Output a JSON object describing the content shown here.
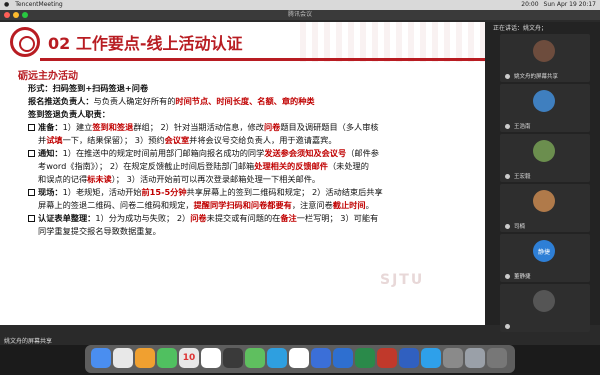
{
  "menubar": {
    "app_name": "TencentMeeting",
    "clock": "Sun Apr 19  20:17",
    "left_items": [
      "",
      "",
      "",
      "",
      "",
      ""
    ],
    "right_items": [
      "20:00"
    ]
  },
  "window": {
    "title": "腾讯会议",
    "share_label": "姚文舟的屏幕共享"
  },
  "slide": {
    "title": "02 工作要点-线上活动认证",
    "section": "砺远主办活动",
    "watermark": "SJTU",
    "lines": [
      {
        "parts": [
          {
            "t": "形式：扫码签到+扫码签退+问卷",
            "c": "bold"
          }
        ]
      },
      {
        "parts": [
          {
            "t": "报名推送负责人：",
            "c": "bold"
          },
          {
            "t": "与负责人确定好所有的",
            "c": ""
          },
          {
            "t": "时间节点、时间长度、名额、章的种类",
            "c": "red"
          }
        ]
      },
      {
        "parts": [
          {
            "t": "签到签退负责人职责：",
            "c": "bold"
          }
        ]
      },
      {
        "bullet": true,
        "parts": [
          {
            "t": "准备：",
            "c": "bold"
          },
          {
            "t": "1）建立",
            "c": ""
          },
          {
            "t": "签到和签退",
            "c": "red"
          },
          {
            "t": "群组；  2）针对当期活动信息，修改",
            "c": ""
          },
          {
            "t": "问卷",
            "c": "red"
          },
          {
            "t": "题目及调研题目（多人审核",
            "c": ""
          }
        ]
      },
      {
        "indent": true,
        "parts": [
          {
            "t": "并",
            "c": ""
          },
          {
            "t": "试填",
            "c": "red"
          },
          {
            "t": "一下，结果保留）；  3）预约",
            "c": ""
          },
          {
            "t": "会议室",
            "c": "red"
          },
          {
            "t": "并将会议号交给负责人，用于邀请嘉宾。",
            "c": ""
          }
        ]
      },
      {
        "bullet": true,
        "parts": [
          {
            "t": "通知：",
            "c": "bold"
          },
          {
            "t": "1）在推送中的规定时间前用部门邮箱向报名成功的同学",
            "c": ""
          },
          {
            "t": "发送参会须知及会议号",
            "c": "red"
          },
          {
            "t": "（邮件参",
            "c": ""
          }
        ]
      },
      {
        "indent": true,
        "parts": [
          {
            "t": "考word《指南》）；  2）在规定反馈截止时间后登陆部门邮箱",
            "c": ""
          },
          {
            "t": "处理相关的反馈邮件",
            "c": "red"
          },
          {
            "t": "（未处理的",
            "c": ""
          }
        ]
      },
      {
        "indent": true,
        "parts": [
          {
            "t": "和误点的记得",
            "c": ""
          },
          {
            "t": "标未读",
            "c": "red"
          },
          {
            "t": "）；  3）活动开始前可以再次登录邮箱处理一下相关邮件。",
            "c": ""
          }
        ]
      },
      {
        "bullet": true,
        "parts": [
          {
            "t": "现场：",
            "c": "bold"
          },
          {
            "t": "1）老规矩，活动开始",
            "c": ""
          },
          {
            "t": "前15-5分钟",
            "c": "red"
          },
          {
            "t": "共享屏幕上的签到二维码和规定；  2）活动结束后共享",
            "c": ""
          }
        ]
      },
      {
        "indent": true,
        "parts": [
          {
            "t": "屏幕上的签退二维码、问卷二维码和规定，",
            "c": ""
          },
          {
            "t": "提醒同学扫码和问卷都要有",
            "c": "red"
          },
          {
            "t": "，注意问卷",
            "c": ""
          },
          {
            "t": "截止时间",
            "c": "red"
          },
          {
            "t": "。",
            "c": ""
          }
        ]
      },
      {
        "bullet": true,
        "parts": [
          {
            "t": "认证表单整理：",
            "c": "bold"
          },
          {
            "t": "1）分为成功与失败；  2）",
            "c": ""
          },
          {
            "t": "问卷",
            "c": "red"
          },
          {
            "t": "未提交或有问题的在",
            "c": ""
          },
          {
            "t": "备注",
            "c": "red"
          },
          {
            "t": "一栏写明；  3）可能有",
            "c": ""
          }
        ]
      },
      {
        "indent": true,
        "parts": [
          {
            "t": "同学重复提交报名导致数据重复。",
            "c": ""
          }
        ]
      }
    ]
  },
  "panel": {
    "speaking_label": "正在讲话：姚文舟；",
    "participants": [
      {
        "name": "姚文舟的屏幕共享",
        "avatar": "",
        "color": "#6d4c3d"
      },
      {
        "name": "王浩南",
        "avatar": "",
        "color": "#3f7fbf"
      },
      {
        "name": "王宏毅",
        "avatar": "",
        "color": "#6b8e4e"
      },
      {
        "name": "司楠",
        "avatar": "",
        "color": "#b07a4a"
      },
      {
        "name": "董静捷",
        "avatar": "静捷",
        "color": "#2e7fd6"
      },
      {
        "name": "",
        "avatar": "",
        "color": "#555555"
      }
    ]
  },
  "dock": {
    "calendar_day": "10",
    "icon_colors": [
      "#4a8ef0",
      "#e8e8e8",
      "#f0a030",
      "#50c060",
      "#e8e8e8",
      "#ffffff",
      "#3a3a3a",
      "#5fbf5f",
      "#2e9fe0",
      "#ffffff",
      "#3b6fd8",
      "#2e6fd0",
      "#2a8a4a",
      "#c0392b",
      "#3060c0",
      "#2ea0ea",
      "#8a8a8a",
      "#9aa0a8",
      "#777777"
    ]
  }
}
